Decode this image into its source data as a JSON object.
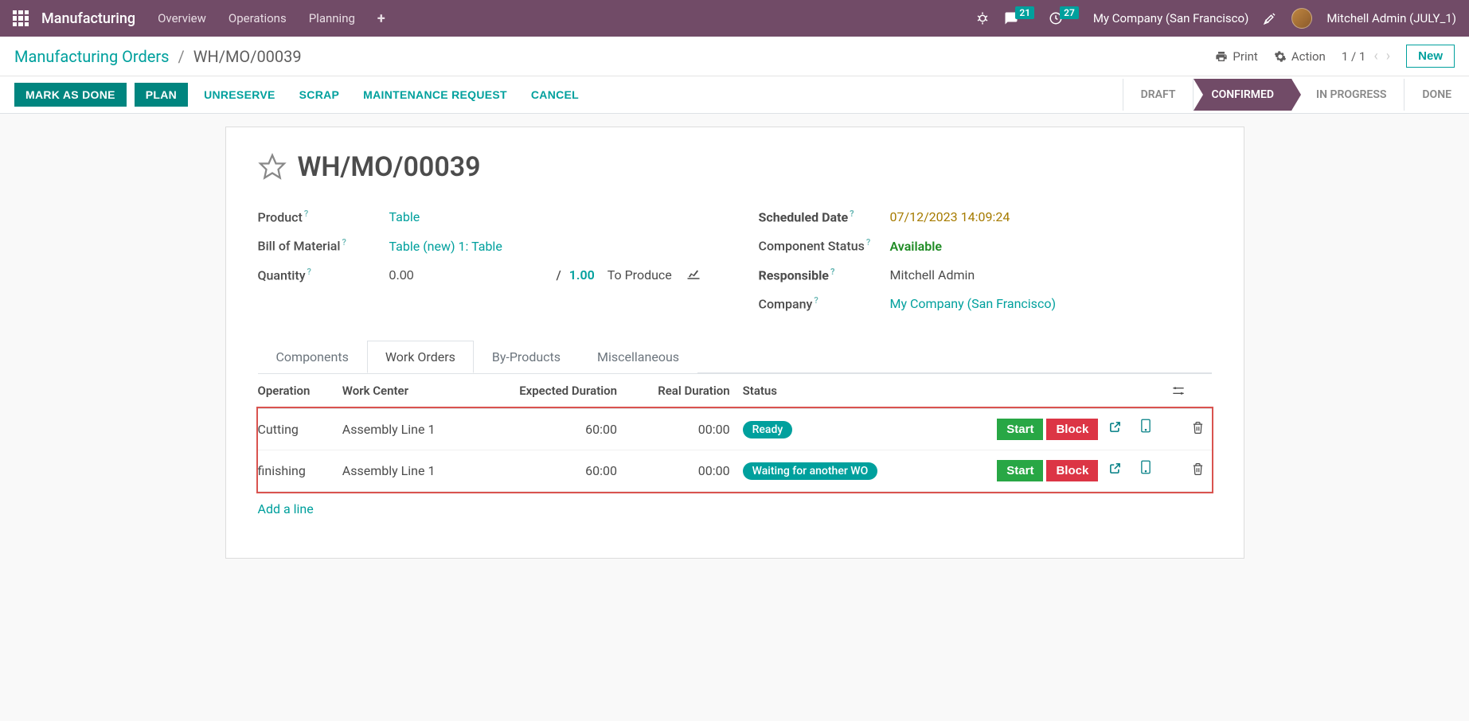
{
  "topnav": {
    "brand": "Manufacturing",
    "items": [
      "Overview",
      "Operations",
      "Planning"
    ],
    "badges": {
      "messages": "21",
      "activities": "27"
    },
    "company": "My Company (San Francisco)",
    "user": "Mitchell Admin (JULY_1)"
  },
  "breadcrumb": {
    "parent": "Manufacturing Orders",
    "current": "WH/MO/00039"
  },
  "controlbar": {
    "print": "Print",
    "action": "Action",
    "pager": "1 / 1",
    "new": "New"
  },
  "actions": {
    "mark_done": "MARK AS DONE",
    "plan": "PLAN",
    "unreserve": "UNRESERVE",
    "scrap": "SCRAP",
    "maintenance": "MAINTENANCE REQUEST",
    "cancel": "CANCEL"
  },
  "status_steps": [
    "DRAFT",
    "CONFIRMED",
    "IN PROGRESS",
    "DONE"
  ],
  "status_active_index": 1,
  "form": {
    "title": "WH/MO/00039",
    "product_label": "Product",
    "product_value": "Table",
    "bom_label": "Bill of Material",
    "bom_value": "Table (new) 1: Table",
    "qty_label": "Quantity",
    "qty_done": "0.00",
    "qty_sep": "/",
    "qty_total": "1.00",
    "qty_unit": "To Produce",
    "sched_label": "Scheduled Date",
    "sched_value": "07/12/2023 14:09:24",
    "compstatus_label": "Component Status",
    "compstatus_value": "Available",
    "responsible_label": "Responsible",
    "responsible_value": "Mitchell Admin",
    "company_label": "Company",
    "company_value": "My Company (San Francisco)"
  },
  "tabs": [
    "Components",
    "Work Orders",
    "By-Products",
    "Miscellaneous"
  ],
  "tab_active_index": 1,
  "table": {
    "headers": {
      "operation": "Operation",
      "work_center": "Work Center",
      "expected": "Expected Duration",
      "real": "Real Duration",
      "status": "Status"
    },
    "rows": [
      {
        "operation": "Cutting",
        "work_center": "Assembly Line 1",
        "expected": "60:00",
        "real": "00:00",
        "status": "Ready",
        "start": "Start",
        "block": "Block"
      },
      {
        "operation": "finishing",
        "work_center": "Assembly Line 1",
        "expected": "60:00",
        "real": "00:00",
        "status": "Waiting for another WO",
        "start": "Start",
        "block": "Block"
      }
    ],
    "add_line": "Add a line"
  }
}
